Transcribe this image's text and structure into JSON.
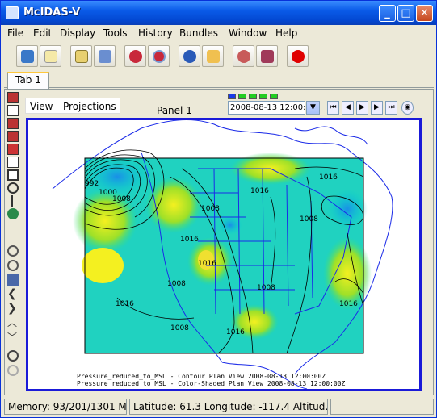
{
  "window": {
    "title": "McIDAS-V",
    "minimize": "_",
    "maximize": "□",
    "close": "✕"
  },
  "menubar": {
    "items": [
      "File",
      "Edit",
      "Display",
      "Tools",
      "History",
      "Bundles",
      "Window",
      "Help"
    ]
  },
  "toolbar": {
    "buttons": [
      "data-explorer-icon",
      "new-display-icon",
      "open-bundle-icon",
      "save-bundle-icon",
      "favorite-bundle-icon",
      "manage-favorites-icon",
      "help-icon",
      "report-icon",
      "dashboard-icon",
      "zoom-data-icon",
      "stop-icon"
    ]
  },
  "tabs": [
    {
      "label": "Tab 1"
    }
  ],
  "panel": {
    "title": "Panel 1",
    "menus": {
      "view": "View",
      "projections": "Projections"
    },
    "time": "2008-08-13 12:00:00Z",
    "anim_steps": 5,
    "map_labels": {
      "line1": "Pressure_reduced_to_MSL - Contour Plan View 2008-08-13 12:00:00Z",
      "line2": "Pressure_reduced_to_MSL - Color-Shaded Plan View 2008-08-13 12:00:00Z"
    },
    "contour_labels": [
      "992",
      "1000",
      "1008",
      "1016",
      "1008",
      "1016",
      "1016",
      "1008",
      "1008",
      "1016",
      "1008",
      "1016",
      "1016",
      "1008",
      "1016"
    ]
  },
  "status": {
    "memory": "Memory: 93/201/1301 MB",
    "position": "Latitude:  61.3 Longitude: -117.4 Altitud..."
  },
  "colors": {
    "accent": "#1a1ad8",
    "title_blue": "#0a5be8",
    "stop_red": "#e00000",
    "coast_blue": "#1a2ae8"
  }
}
